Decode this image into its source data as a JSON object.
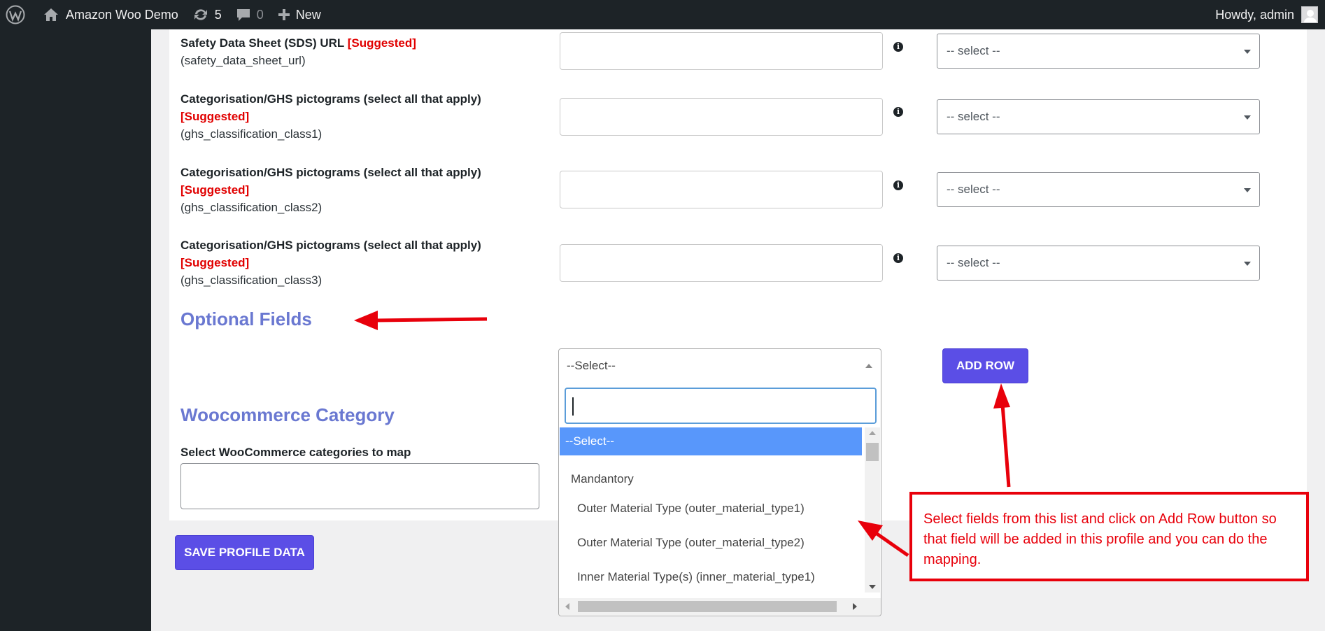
{
  "adminbar": {
    "site_name": "Amazon Woo Demo",
    "updates_count": "5",
    "comments_count": "0",
    "new_label": "New",
    "howdy": "Howdy, admin"
  },
  "fields": [
    {
      "title": "Safety Data Sheet (SDS) URL",
      "badge": "[Suggested]",
      "key": "(safety_data_sheet_url)",
      "select": "-- select --"
    },
    {
      "title": "Categorisation/GHS pictograms (select all that apply)",
      "badge": "[Suggested]",
      "key": "(ghs_classification_class1)",
      "select": "-- select --"
    },
    {
      "title": "Categorisation/GHS pictograms (select all that apply)",
      "badge": "[Suggested]",
      "key": "(ghs_classification_class2)",
      "select": "-- select --"
    },
    {
      "title": "Categorisation/GHS pictograms (select all that apply)",
      "badge": "[Suggested]",
      "key": "(ghs_classification_class3)",
      "select": "-- select --"
    }
  ],
  "optional": {
    "heading": "Optional Fields",
    "select_value": "--Select--",
    "add_row": "ADD ROW",
    "dropdown": {
      "selected": "--Select--",
      "group": "Mandantory",
      "options": [
        "Outer Material Type (outer_material_type1)",
        "Outer Material Type (outer_material_type2)",
        "Inner Material Type(s) (inner_material_type1)"
      ]
    }
  },
  "woo": {
    "heading": "Woocommerce Category",
    "label": "Select WooCommerce categories to map"
  },
  "save_label": "SAVE PROFILE DATA",
  "note": "Select fields from this list and click on Add Row button so that field will be added in this profile and you can do the mapping.",
  "colors": {
    "accent": "#5b4ee6",
    "heading": "#6a78d1",
    "suggested": "#e10000",
    "annotation": "#e8000b",
    "highlight": "#5897fb"
  }
}
